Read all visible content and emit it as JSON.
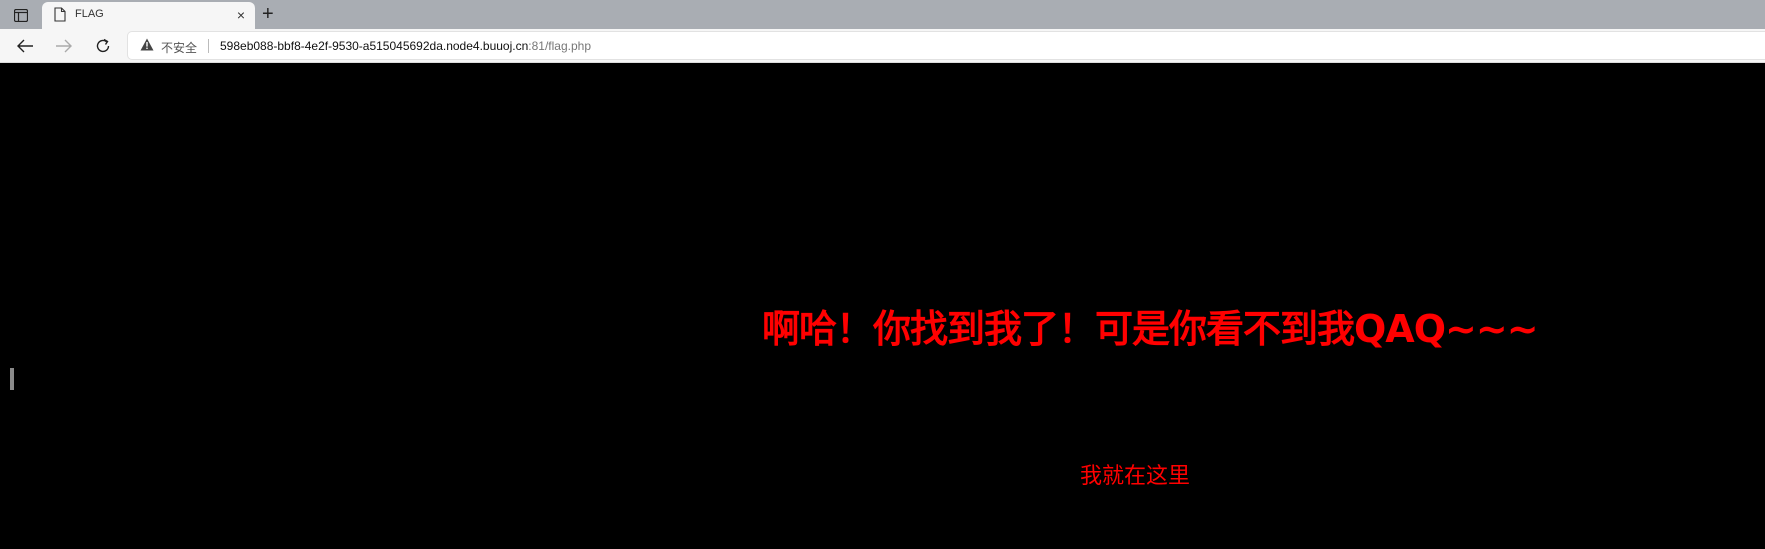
{
  "browser": {
    "tab": {
      "title": "FLAG",
      "close_glyph": "×"
    },
    "new_tab_glyph": "+",
    "icons": {
      "tab_actions": "tab-actions-icon",
      "page": "document-icon",
      "back": "back-arrow-icon",
      "forward": "forward-arrow-icon",
      "reload": "reload-icon",
      "security": "warning-triangle-icon"
    },
    "address": {
      "security_label": "不安全",
      "host": "598eb088-bbf8-4e2f-9530-a515045692da.node4.buuoj.cn",
      "port_path": ":81/flag.php"
    }
  },
  "page": {
    "headline": "啊哈！你找到我了！可是你看不到我QAQ~~~",
    "hint": "我就在这里",
    "text_color": "#ff0000",
    "background": "#000000"
  }
}
